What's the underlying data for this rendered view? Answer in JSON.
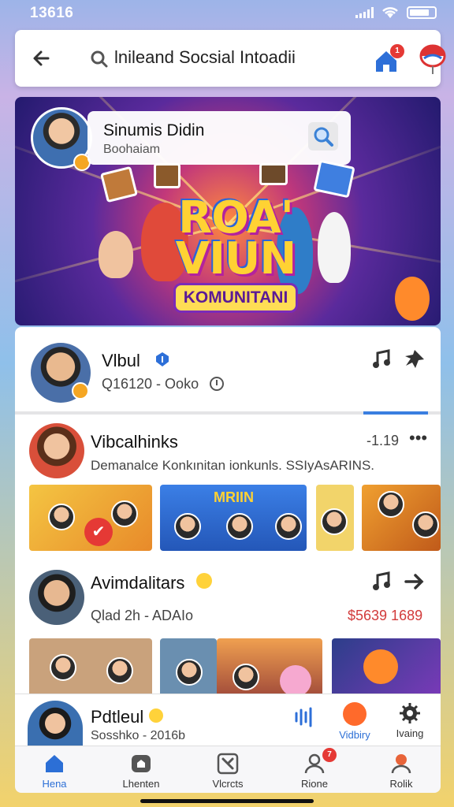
{
  "status": {
    "time": "13616"
  },
  "topbar": {
    "title": "lnileand Socsial Intoadii",
    "notification_count": "1"
  },
  "banner": {
    "profile_name": "Sinumis Didin",
    "profile_subtitle": "Boohaiam",
    "headline": "ROA' VIUN",
    "subheadline": "KOMUNITANI"
  },
  "current_user": {
    "name": "Vlbul",
    "meta": "Q16120 - Ooko"
  },
  "posts": [
    {
      "author": "Vibcalhinks",
      "time": "-1.19",
      "body": "Demanalce Konkınitan ionkunls. SSIyAsARINS."
    },
    {
      "author": "Avimdalitars",
      "meta": "Qlad 2h - ADAIo",
      "price": "$5639 1689",
      "thumb_label": "MRIIN"
    }
  ],
  "mini_profile": {
    "name": "Pdtleul",
    "meta": "Sosshko - 2016b"
  },
  "actions": [
    {
      "label": "Vidbiry"
    },
    {
      "label": "Ivaing"
    }
  ],
  "nav": {
    "items": [
      {
        "label": "Hena"
      },
      {
        "label": "Lhenten"
      },
      {
        "label": "Vlcrcts"
      },
      {
        "label": "Rione",
        "badge": "7"
      },
      {
        "label": "Rolik"
      }
    ]
  },
  "colors": {
    "accent": "#2c6fd6",
    "badge": "#e53935",
    "highlight": "#f5a623"
  }
}
